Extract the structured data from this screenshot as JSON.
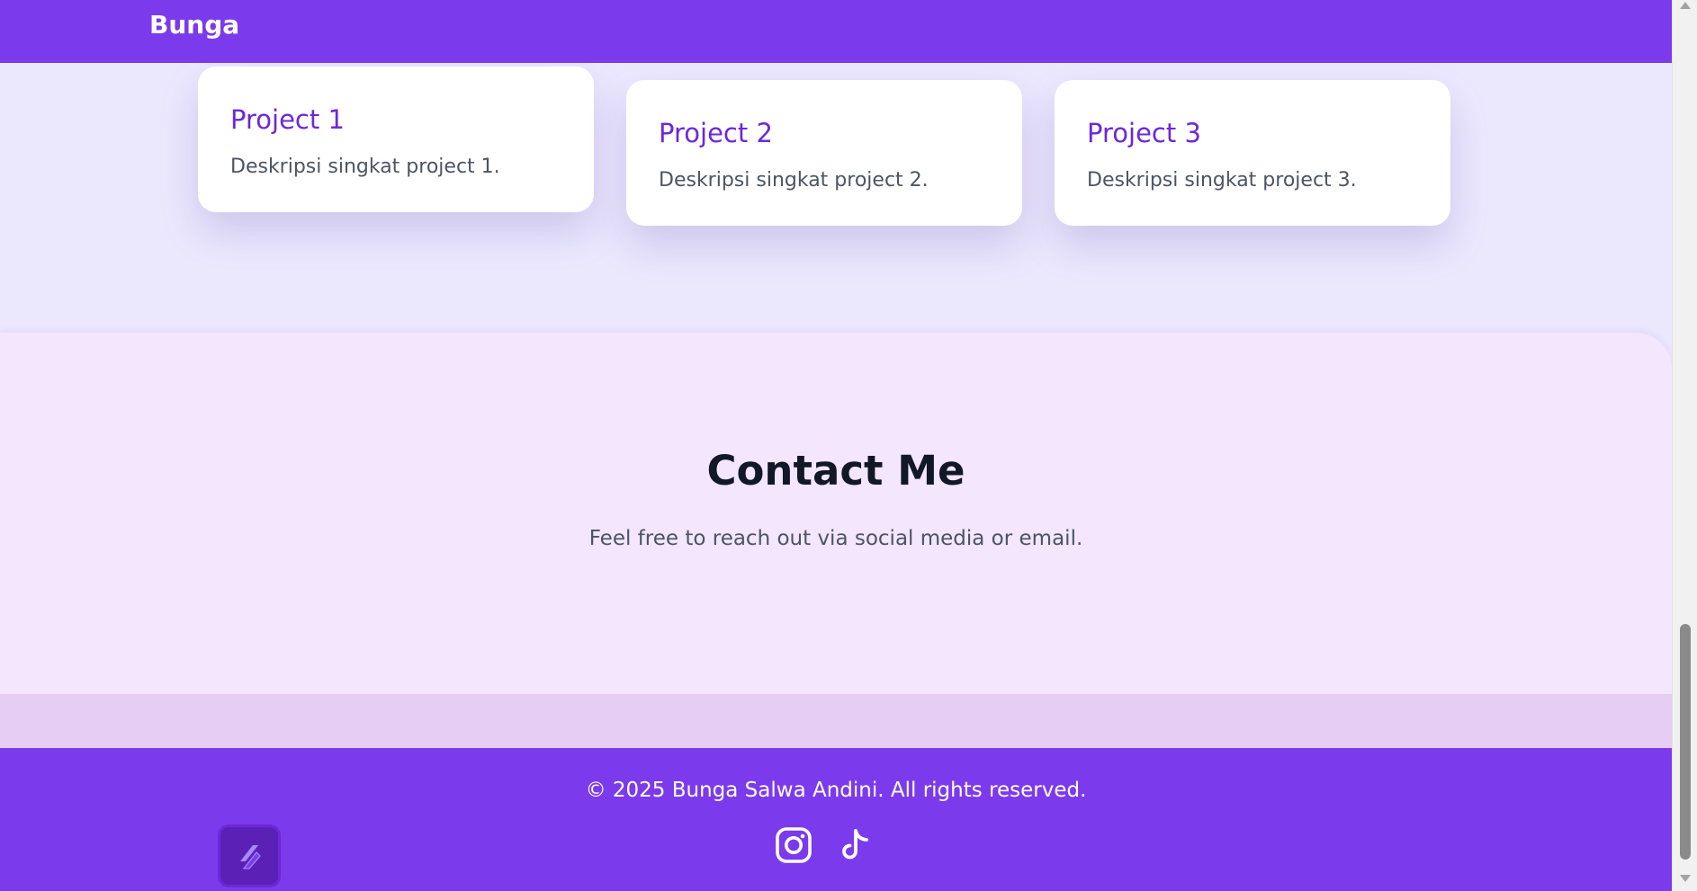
{
  "navbar": {
    "brand": "Bunga"
  },
  "projects": [
    {
      "title": "Project 1",
      "description": "Deskripsi singkat project 1."
    },
    {
      "title": "Project 2",
      "description": "Deskripsi singkat project 2."
    },
    {
      "title": "Project 3",
      "description": "Deskripsi singkat project 3."
    }
  ],
  "contact": {
    "title": "Contact Me",
    "text": "Feel free to reach out via social media or email."
  },
  "footer": {
    "copyright": "© 2025 Bunga Salwa Andini. All rights reserved.",
    "social": [
      {
        "icon": "instagram-icon"
      },
      {
        "icon": "tiktok-icon"
      }
    ]
  },
  "colors": {
    "primary": "#7c3aed",
    "project_title": "#6d28d9",
    "projects_bg": "#ebe8fe",
    "contact_bg": "#f4e6fd",
    "band_bg": "#e5cdf3"
  }
}
